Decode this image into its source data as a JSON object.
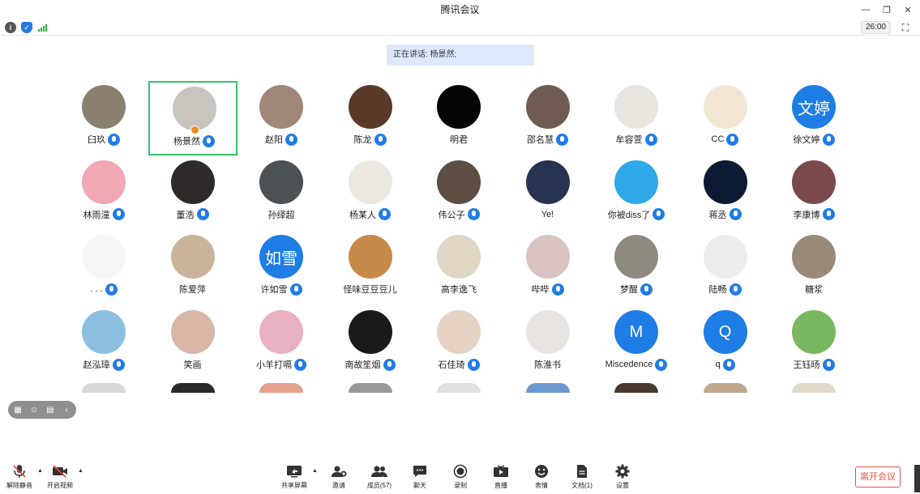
{
  "window": {
    "title": "腾讯会议"
  },
  "status": {
    "timer": "26:00"
  },
  "speaking": {
    "text": "正在讲话: 杨景然;"
  },
  "participants": [
    {
      "name": "臼玖",
      "mic": "on",
      "avatar_color": "#8a8070"
    },
    {
      "name": "杨景然",
      "mic": "on",
      "avatar_color": "#c9c4be",
      "active": true,
      "host": true
    },
    {
      "name": "赵阳",
      "mic": "on",
      "avatar_color": "#a08878"
    },
    {
      "name": "陈龙",
      "mic": "on",
      "avatar_color": "#5a3a28"
    },
    {
      "name": "明君",
      "mic": "none",
      "avatar_color": "#050505"
    },
    {
      "name": "邵名慧",
      "mic": "on",
      "avatar_color": "#6f5b52"
    },
    {
      "name": "牟容萱",
      "mic": "on",
      "avatar_color": "#e8e4de"
    },
    {
      "name": "CC",
      "mic": "on",
      "avatar_color": "#f2e6d2"
    },
    {
      "name": "徐文婷",
      "mic": "on",
      "avatar_color": "#1f7de6",
      "avatar_text": "文婷"
    },
    {
      "name": "林雨潼",
      "mic": "on",
      "avatar_color": "#f2a7b4"
    },
    {
      "name": "董浩",
      "mic": "on",
      "avatar_color": "#2e2a2a"
    },
    {
      "name": "孙绎超",
      "mic": "none",
      "avatar_color": "#4c5156"
    },
    {
      "name": "杨某人",
      "mic": "on",
      "avatar_color": "#ece8e0"
    },
    {
      "name": "伟公子",
      "mic": "on",
      "avatar_color": "#5e4d42"
    },
    {
      "name": "Ye!",
      "mic": "none",
      "avatar_color": "#283350"
    },
    {
      "name": "你被diss了",
      "mic": "on",
      "avatar_color": "#2ea8e8"
    },
    {
      "name": "蒋丞",
      "mic": "on",
      "avatar_color": "#0d1a33"
    },
    {
      "name": "李康博",
      "mic": "on",
      "avatar_color": "#7a4a4a"
    },
    {
      "name": ". . .",
      "mic": "on",
      "avatar_color": "#f6f6f6"
    },
    {
      "name": "陈爱萍",
      "mic": "none",
      "avatar_color": "#c9b49a"
    },
    {
      "name": "许如雪",
      "mic": "on",
      "avatar_color": "#1f7de6",
      "avatar_text": "如雪"
    },
    {
      "name": "怪味豆豆豆儿",
      "mic": "none",
      "avatar_color": "#c88a4a"
    },
    {
      "name": "高李逸飞",
      "mic": "none",
      "avatar_color": "#e0d6c4"
    },
    {
      "name": "哔哔",
      "mic": "on",
      "avatar_color": "#d9c3c0"
    },
    {
      "name": "梦醒",
      "mic": "on",
      "avatar_color": "#8f8a80"
    },
    {
      "name": "陆畅",
      "mic": "on",
      "avatar_color": "#ededed"
    },
    {
      "name": "糖浆",
      "mic": "none",
      "avatar_color": "#9a8878"
    },
    {
      "name": "赵泓璋",
      "mic": "on",
      "avatar_color": "#8cc0e0"
    },
    {
      "name": "笑画",
      "mic": "none",
      "avatar_color": "#d8b7a6"
    },
    {
      "name": "小羊打嗝",
      "mic": "on",
      "avatar_color": "#e8b0c0"
    },
    {
      "name": "南故笙烟",
      "mic": "on",
      "avatar_color": "#1a1a1a"
    },
    {
      "name": "石佳琦",
      "mic": "on",
      "avatar_color": "#e6d2c2"
    },
    {
      "name": "陈淮书",
      "mic": "none",
      "avatar_color": "#e8e4e0"
    },
    {
      "name": "Miscedence",
      "mic": "on",
      "avatar_color": "#1f7de6",
      "avatar_text": "M"
    },
    {
      "name": "q",
      "mic": "on",
      "avatar_color": "#1f7de6",
      "avatar_text": "Q"
    },
    {
      "name": "王钰旸",
      "mic": "on",
      "avatar_color": "#7ab860"
    }
  ],
  "next_row_colors": [
    "#d8d8d8",
    "#2a2a2a",
    "#e6a090",
    "#9a9a9a",
    "#e0e0e0",
    "#6a9ad0",
    "#4a3a30",
    "#c0a890",
    "#e0d8c8"
  ],
  "toolbar": {
    "unmute": "解除静音",
    "start_video": "开启视频",
    "share_screen": "共享屏幕",
    "invite": "邀请",
    "members": "成员(57)",
    "chat": "聊天",
    "record": "录制",
    "live": "直播",
    "reactions": "表情",
    "docs": "文档(1)",
    "settings": "设置",
    "leave": "离开会议"
  }
}
